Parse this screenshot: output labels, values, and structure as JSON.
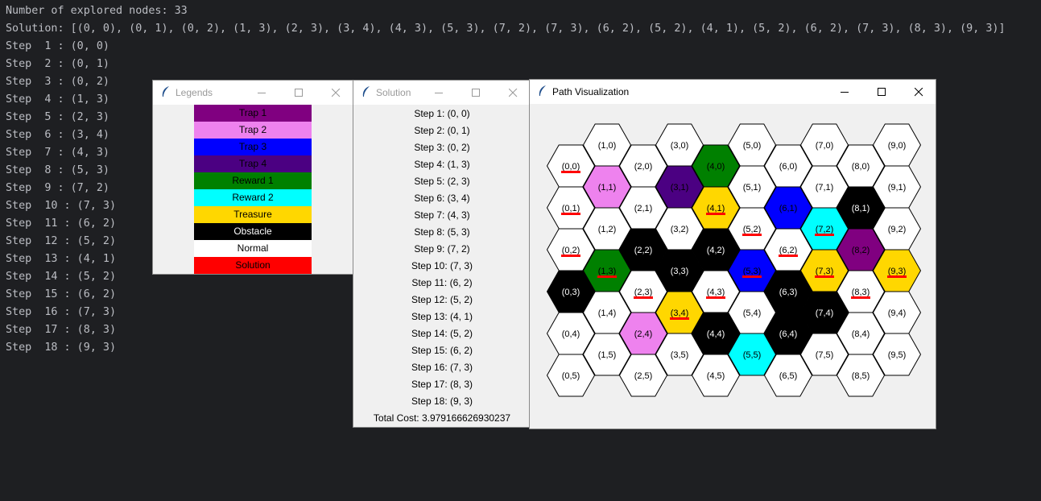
{
  "console": {
    "lines": [
      "Number of explored nodes: 33",
      "Solution: [(0, 0), (0, 1), (0, 2), (1, 3), (2, 3), (3, 4), (4, 3), (5, 3), (7, 2), (7, 3), (6, 2), (5, 2), (4, 1), (5, 2), (6, 2), (7, 3), (8, 3), (9, 3)]",
      "Step  1 : (0, 0)",
      "Step  2 : (0, 1)",
      "Step  3 : (0, 2)",
      "Step  4 : (1, 3)",
      "Step  5 : (2, 3)",
      "Step  6 : (3, 4)",
      "Step  7 : (4, 3)",
      "Step  8 : (5, 3)",
      "Step  9 : (7, 2)",
      "Step  10 : (7, 3)",
      "Step  11 : (6, 2)",
      "Step  12 : (5, 2)",
      "Step  13 : (4, 1)",
      "Step  14 : (5, 2)",
      "Step  15 : (6, 2)",
      "Step  16 : (7, 3)",
      "Step  17 : (8, 3)",
      "Step  18 : (9, 3)"
    ]
  },
  "legends_window": {
    "title": "Legends",
    "items": [
      {
        "label": "Trap 1",
        "color": "#800080",
        "text_color": "#000000"
      },
      {
        "label": "Trap 2",
        "color": "#ee82ee",
        "text_color": "#000000"
      },
      {
        "label": "Trap 3",
        "color": "#0000ff",
        "text_color": "#000000"
      },
      {
        "label": "Trap 4",
        "color": "#4b0082",
        "text_color": "#000000"
      },
      {
        "label": "Reward 1",
        "color": "#008000",
        "text_color": "#000000"
      },
      {
        "label": "Reward 2",
        "color": "#00ffff",
        "text_color": "#000000"
      },
      {
        "label": "Treasure",
        "color": "#ffd700",
        "text_color": "#000000"
      },
      {
        "label": "Obstacle",
        "color": "#000000",
        "text_color": "#ffffff"
      },
      {
        "label": "Normal",
        "color": "#ffffff",
        "text_color": "#000000"
      },
      {
        "label": "Solution",
        "color": "#ff0000",
        "text_color": "#000000"
      }
    ]
  },
  "solution_window": {
    "title": "Solution",
    "steps": [
      "Step 1: (0, 0)",
      "Step 2: (0, 1)",
      "Step 3: (0, 2)",
      "Step 4: (1, 3)",
      "Step 5: (2, 3)",
      "Step 6: (3, 4)",
      "Step 7: (4, 3)",
      "Step 8: (5, 3)",
      "Step 9: (7, 2)",
      "Step 10: (7, 3)",
      "Step 11: (6, 2)",
      "Step 12: (5, 2)",
      "Step 13: (4, 1)",
      "Step 14: (5, 2)",
      "Step 15: (6, 2)",
      "Step 16: (7, 3)",
      "Step 17: (8, 3)",
      "Step 18: (9, 3)"
    ],
    "total_cost": "Total Cost: 3.979166626930237"
  },
  "path_window": {
    "title": "Path Visualization",
    "grid_cols": 10,
    "grid_rows": 6,
    "colors": {
      "trap1": "#800080",
      "trap2": "#ee82ee",
      "trap3": "#0000ff",
      "trap4": "#4b0082",
      "reward1": "#008000",
      "reward2": "#00ffff",
      "treasure": "#ffd700",
      "obstacle": "#000000",
      "normal": "#ffffff",
      "solution": "#ff0000"
    },
    "special_cells": {
      "1,1": "trap2",
      "3,1": "trap4",
      "4,0": "reward1",
      "4,1": "treasure",
      "6,1": "trap3",
      "7,2": "reward2",
      "8,1": "obstacle",
      "8,2": "trap1",
      "9,3": "treasure",
      "2,2": "obstacle",
      "4,2": "obstacle",
      "5,3": "trap3",
      "1,3": "reward1",
      "3,3": "obstacle",
      "0,3": "obstacle",
      "7,3": "treasure",
      "6,3": "obstacle",
      "7,4": "obstacle",
      "3,4": "treasure",
      "2,4": "trap2",
      "4,4": "obstacle",
      "6,4": "obstacle",
      "5,5": "reward2"
    },
    "solution_cells": [
      "0,0",
      "0,1",
      "0,2",
      "1,3",
      "2,3",
      "3,4",
      "4,3",
      "5,3",
      "7,2",
      "7,3",
      "6,2",
      "5,2",
      "4,1",
      "8,3",
      "9,3"
    ]
  }
}
